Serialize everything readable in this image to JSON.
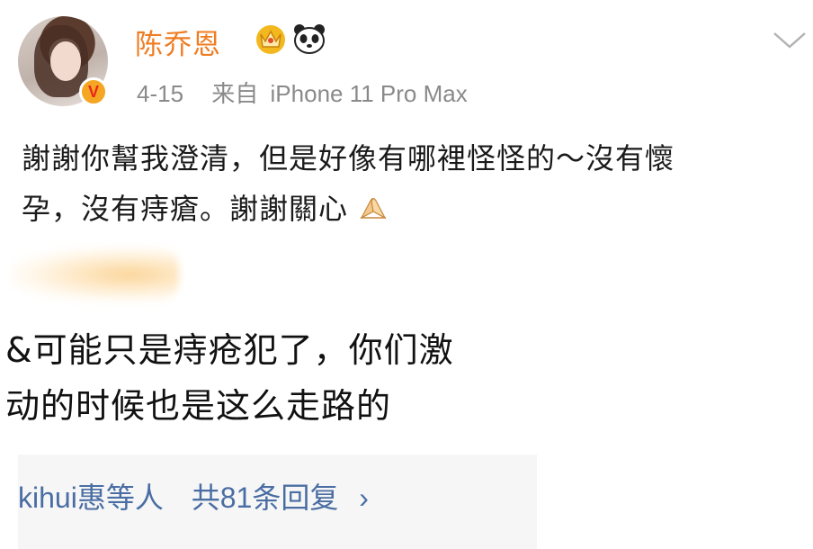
{
  "post": {
    "author": "陈乔恩",
    "date": "4-15",
    "source_label": "来自",
    "device": "iPhone 11 Pro Max",
    "text_line1": "謝謝你幫我澄清，但是好像有哪裡怪怪的～沒有懷",
    "text_line2": "孕，沒有痔瘡。謝謝關心",
    "emoji": "folded-hands"
  },
  "comment": {
    "line1": "&可能只是痔疮犯了，你们激",
    "line2": "动的时候也是这么走路的"
  },
  "replies": {
    "who": "kihui惠等人",
    "count_text": "共81条回复",
    "arrow": "›"
  },
  "colors": {
    "author": "#f07c22",
    "meta": "#8a8a8a",
    "link": "#4a6ea3",
    "reply_bg": "#f6f6f6"
  }
}
